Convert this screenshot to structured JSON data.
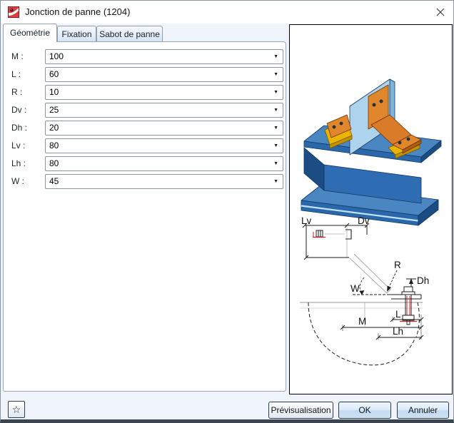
{
  "window": {
    "title": "Jonction de panne (1204)"
  },
  "tabs": [
    {
      "label": "Géométrie",
      "active": true
    },
    {
      "label": "Fixation",
      "active": false
    },
    {
      "label": "Sabot de panne",
      "active": false
    }
  ],
  "fields": [
    {
      "label": "M :",
      "value": "100"
    },
    {
      "label": "L :",
      "value": "60"
    },
    {
      "label": "R :",
      "value": "10"
    },
    {
      "label": "Dv :",
      "value": "25"
    },
    {
      "label": "Dh :",
      "value": "20"
    },
    {
      "label": "Lv :",
      "value": "80"
    },
    {
      "label": "Lh :",
      "value": "80"
    },
    {
      "label": "W :",
      "value": "45"
    }
  ],
  "icons": {
    "dropdown": "▼",
    "favorite": "☆"
  },
  "preview": {
    "labels": {
      "lv": "Lv",
      "dv": "Dv",
      "r": "R",
      "w": "W",
      "dh": "Dh",
      "l": "L",
      "m": "M",
      "lh": "Lh"
    }
  },
  "footer": {
    "preview_label": "Prévisualisation",
    "ok_label": "OK",
    "cancel_label": "Annuler"
  },
  "colors": {
    "beam_blue": "#2e6db4",
    "plate_blue": "#aed3ec",
    "bracket_orange": "#e0862c",
    "pad_gold": "#eab500",
    "highlight_red": "#d42020"
  }
}
